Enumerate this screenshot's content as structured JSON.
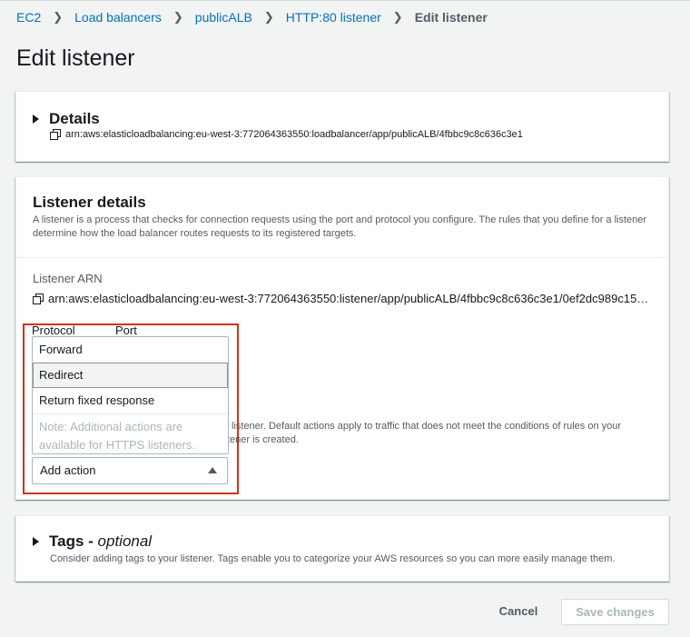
{
  "breadcrumb": {
    "items": [
      "EC2",
      "Load balancers",
      "publicALB",
      "HTTP:80 listener"
    ],
    "current": "Edit listener"
  },
  "page": {
    "title": "Edit listener"
  },
  "details": {
    "title": "Details",
    "arn": "arn:aws:elasticloadbalancing:eu-west-3:772064363550:loadbalancer/app/publicALB/4fbbc9c8c636c3e1"
  },
  "listener_details": {
    "title": "Listener details",
    "description": "A listener is a process that checks for connection requests using the port and protocol you configure. The rules that you define for a listener determine how the load balancer routes requests to its registered targets.",
    "arn_label": "Listener ARN",
    "arn_value": "arn:aws:elasticloadbalancing:eu-west-3:772064363550:listener/app/publicALB/4fbbc9c8c636c3e1/0ef2dc989c15…",
    "protocol_label": "Protocol",
    "port_label": "Port",
    "default_actions_text_line1": "listener. Default actions apply to traffic that does not meet the conditions of rules on your",
    "default_actions_text_line2": "tener is created."
  },
  "add_action_dropdown": {
    "options": [
      "Forward",
      "Redirect",
      "Return fixed response"
    ],
    "hovered_option": "Redirect",
    "note": "Note: Additional actions are available for HTTPS listeners.",
    "button_label": "Add action"
  },
  "tags": {
    "title": "Tags",
    "optional": "optional",
    "separator": " - ",
    "description": "Consider adding tags to your listener. Tags enable you to categorize your AWS resources so you can more easily manage them."
  },
  "footer": {
    "cancel_label": "Cancel",
    "save_label": "Save changes"
  },
  "colors": {
    "link": "#0073bb",
    "highlight_border": "#d13212",
    "background": "#f2f3f3"
  }
}
